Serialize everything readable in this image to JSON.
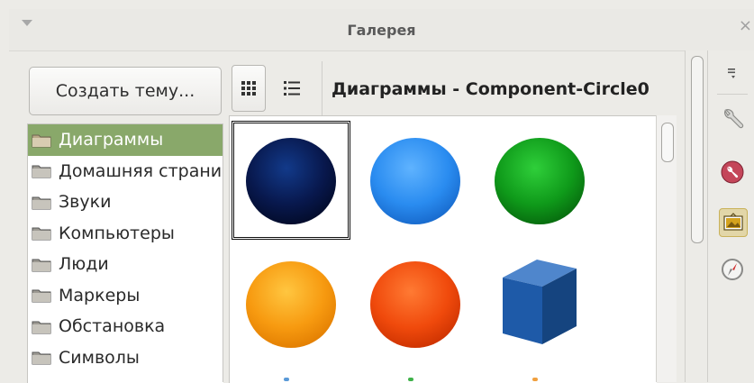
{
  "window": {
    "title": "Галерея",
    "close_glyph": "×"
  },
  "toolbar": {
    "create_theme_label": "Создать тему...",
    "theme_heading": "Диаграммы - Component-Circle0"
  },
  "themes": [
    {
      "label": "Диаграммы",
      "selected": true
    },
    {
      "label": "Домашняя страница"
    },
    {
      "label": "Звуки"
    },
    {
      "label": "Компьютеры"
    },
    {
      "label": "Люди"
    },
    {
      "label": "Маркеры"
    },
    {
      "label": "Обстановка"
    },
    {
      "label": "Символы"
    }
  ],
  "gallery_items": [
    {
      "name": "dark-blue-sphere",
      "color": "#0a1f5c"
    },
    {
      "name": "blue-sphere",
      "color": "#2a8cf0"
    },
    {
      "name": "green-sphere",
      "color": "#0f9a1a"
    },
    {
      "name": "orange-sphere",
      "color": "#f79a10"
    },
    {
      "name": "red-orange-sphere",
      "color": "#f04a0c"
    },
    {
      "name": "blue-cube",
      "color": "#1e5aa8"
    }
  ],
  "sidebar_icons": [
    "sidebar-menu-icon",
    "properties-wrench-icon",
    "styles-icon",
    "gallery-icon",
    "navigator-compass-icon"
  ],
  "colors": {
    "selection": "#89a86a",
    "accent_red": "#c4465a",
    "accent_gold": "#d4a21e"
  }
}
